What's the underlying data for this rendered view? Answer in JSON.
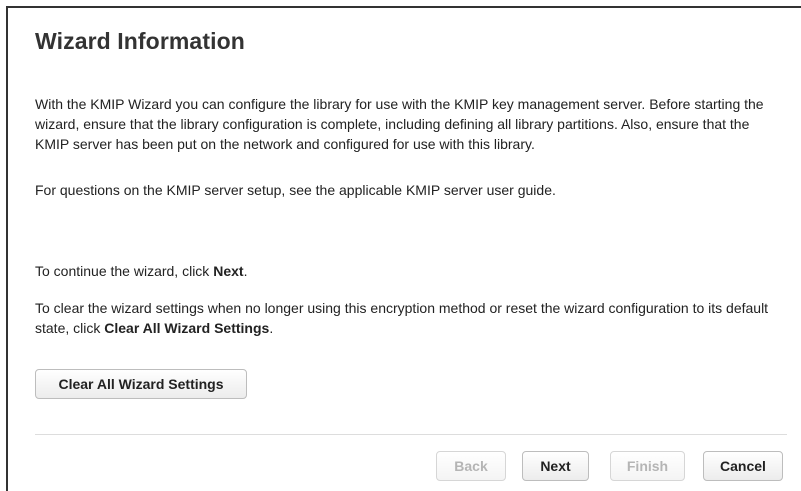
{
  "title": "Wizard Information",
  "intro": {
    "p1": "With the KMIP Wizard you can configure the library for use with the KMIP key management server. Before starting the wizard, ensure that the library configuration is complete, including defining all library partitions. Also, ensure that the KMIP server has been put on the network and configured for use with this library.",
    "p2": "For questions on the KMIP server setup, see the applicable KMIP server user guide."
  },
  "continue_text": {
    "before": "To continue the wizard, click ",
    "bold": "Next",
    "after": "."
  },
  "clear_text": {
    "before": "To clear the wizard settings when no longer using this encryption method or reset the wizard configuration to its default state, click ",
    "bold": "Clear All Wizard Settings",
    "after": "."
  },
  "buttons": {
    "clear_all": "Clear All Wizard Settings",
    "back": "Back",
    "next": "Next",
    "finish": "Finish",
    "cancel": "Cancel"
  }
}
